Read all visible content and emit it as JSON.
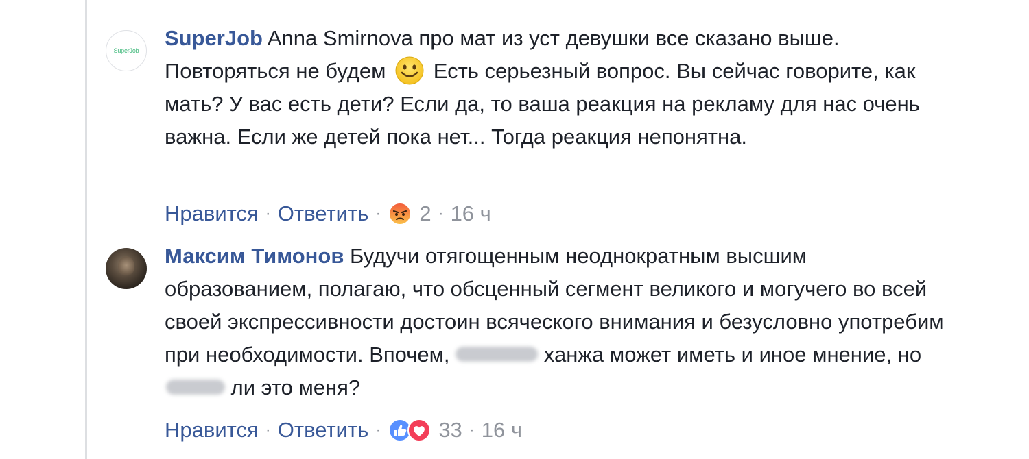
{
  "comments": [
    {
      "author": "SuperJob",
      "avatar_text": "SuperJob",
      "text_parts": {
        "a": "Anna Smirnova про мат из уст девушки все сказано выше. Повторяться не будем",
        "b": "Есть серьезный вопрос. Вы сейчас говорите, как мать? У вас есть дети? Если да, то ваша реакция на рекламу для нас очень важна. Если же детей пока нет... Тогда реакция непонятна."
      },
      "emoji": "smile-emoji",
      "actions": {
        "like": "Нравится",
        "reply": "Ответить",
        "reaction_icons": [
          "angry-reaction-icon"
        ],
        "reaction_count": "2",
        "time": "16 ч"
      }
    },
    {
      "author": "Максим Тимонов",
      "text_parts": {
        "a": "Будучи отягощенным неоднократным высшим образованием, полагаю, что обсценный сегмент великого и могучего во всей своей экспрессивности достоин всяческого внимания и безусловно употребим при необходимости. Впочем,",
        "b": "ханжа может иметь и иное мнение, но",
        "c": "ли это меня?"
      },
      "actions": {
        "like": "Нравится",
        "reply": "Ответить",
        "reaction_icons": [
          "like-reaction-icon",
          "love-reaction-icon"
        ],
        "reaction_count": "33",
        "time": "16 ч"
      }
    }
  ],
  "colors": {
    "author": "#385898",
    "text": "#1d2129",
    "meta": "#90949c",
    "like_blue": "#5890ff",
    "love_red": "#f33e58",
    "angry_orange": "#f7714c"
  }
}
